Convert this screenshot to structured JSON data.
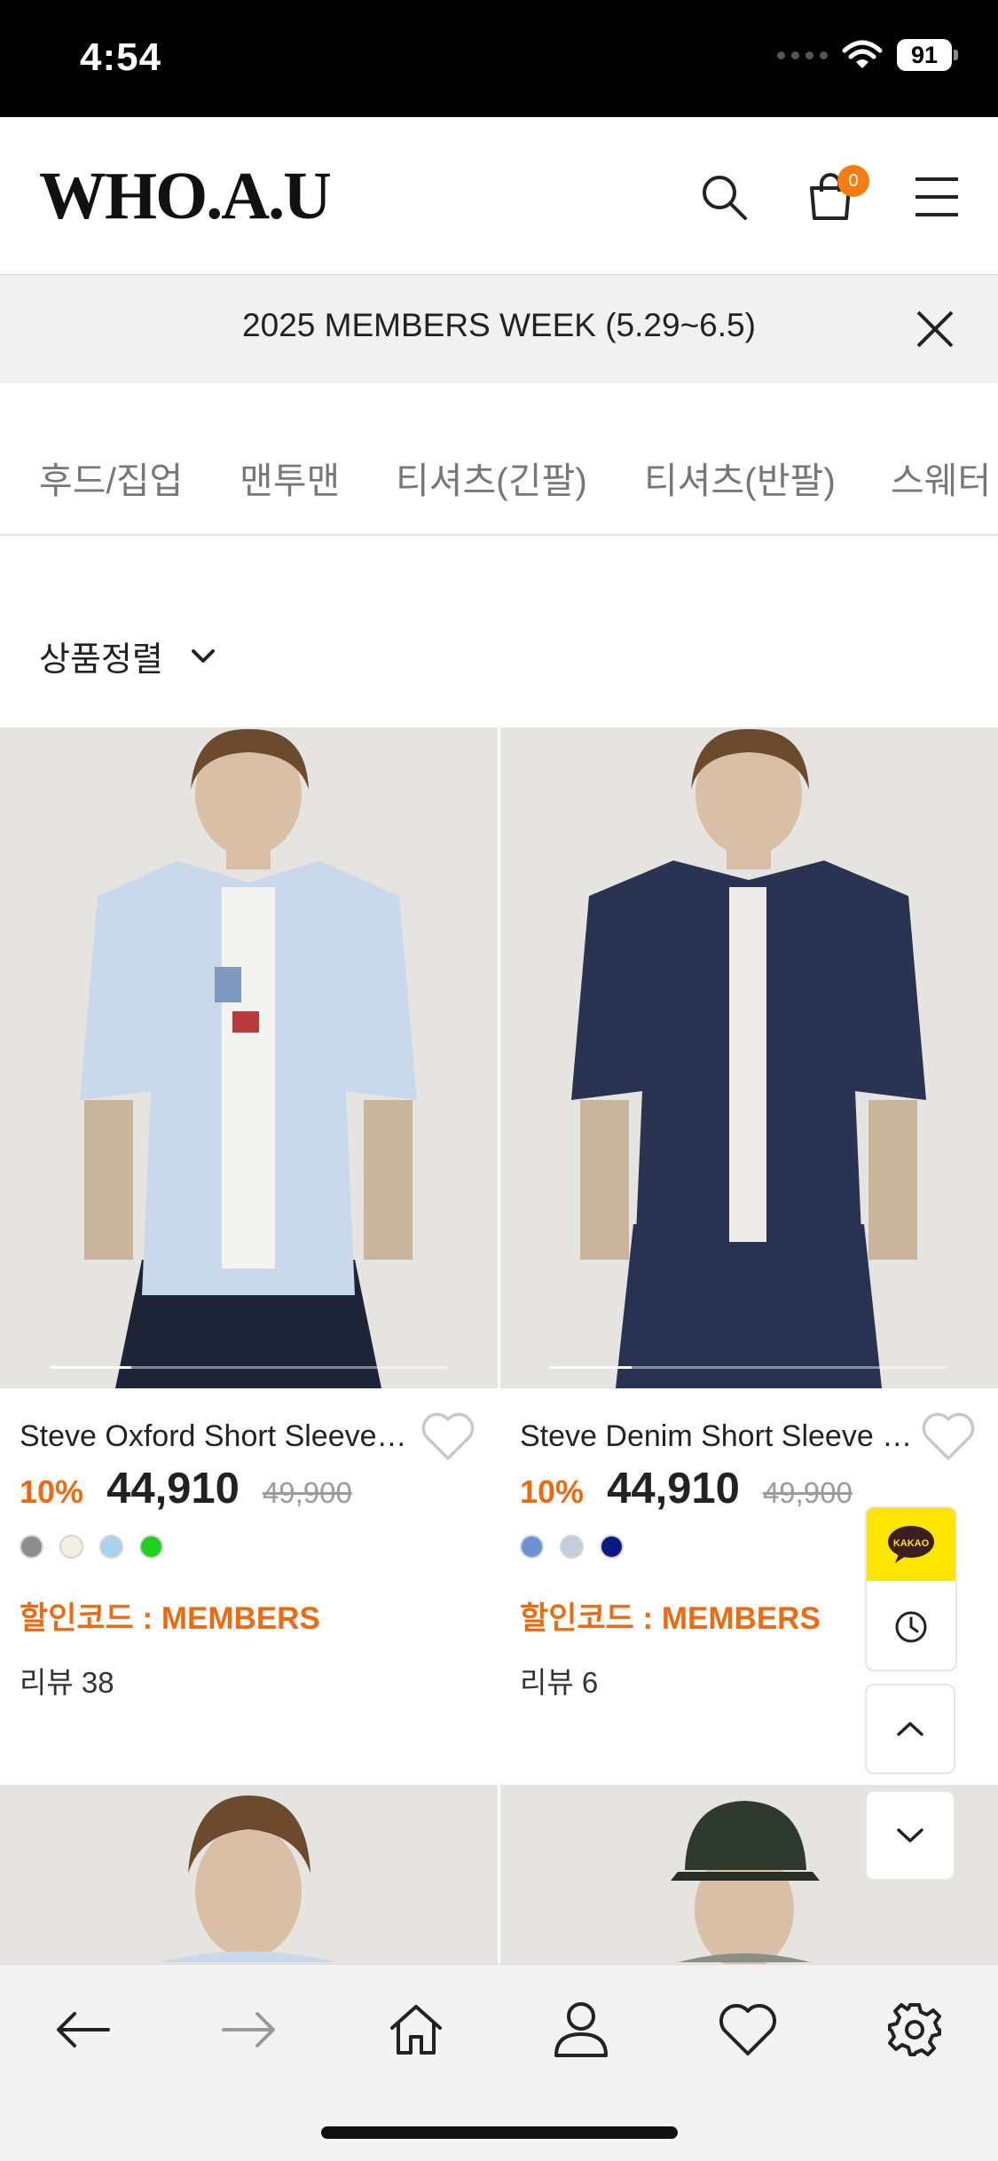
{
  "status_bar": {
    "time": "4:54",
    "battery": "91"
  },
  "header": {
    "logo": "WHO.A.U",
    "cart_count": "0"
  },
  "banner": {
    "text": "2025 MEMBERS WEEK (5.29~6.5)"
  },
  "categories": [
    "후드/집업",
    "맨투맨",
    "티셔츠(긴팔)",
    "티셔츠(반팔)",
    "스웨터"
  ],
  "sort": {
    "label": "상품정렬"
  },
  "products": [
    {
      "name": "Steve Oxford Short Sleeve Shirt",
      "discount": "10%",
      "price": "44,910",
      "original_price": "49,900",
      "swatches": [
        "#8e8e8e",
        "#f3efe0",
        "#a9d3ec",
        "#1fd01f"
      ],
      "promo": "할인코드 : MEMBERS",
      "review": "리뷰 38",
      "image_tone": "#e4e3df"
    },
    {
      "name": "Steve Denim Short Sleeve Shirt",
      "discount": "10%",
      "price": "44,910",
      "original_price": "49,900",
      "swatches": [
        "#6f8fd6",
        "#c2cedc",
        "#0c1a80"
      ],
      "promo": "할인코드 : MEMBERS",
      "review": "리뷰 6",
      "image_tone": "#e4e3df"
    }
  ],
  "floating": {
    "kakao_label": "KAKAO"
  },
  "colors": {
    "accent": "#ec6b12",
    "badge": "#f47c12",
    "kakao": "#fee500"
  }
}
